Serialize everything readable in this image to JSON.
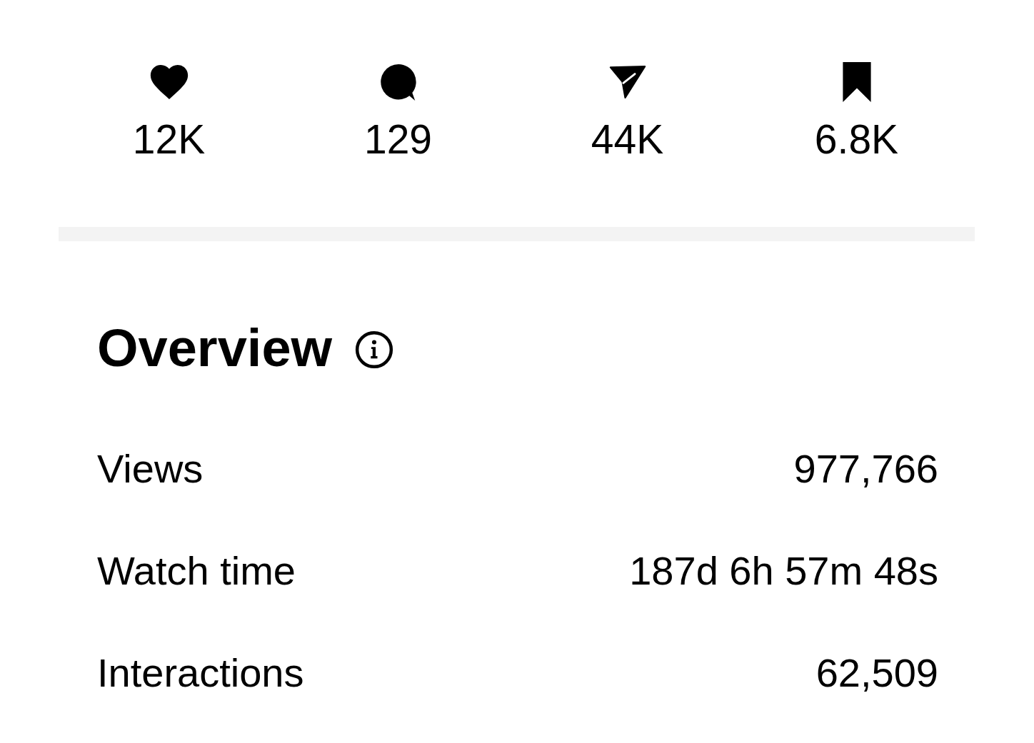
{
  "stats": [
    {
      "kind": "likes",
      "value": "12K"
    },
    {
      "kind": "comments",
      "value": "129"
    },
    {
      "kind": "shares",
      "value": "44K"
    },
    {
      "kind": "saves",
      "value": "6.8K"
    }
  ],
  "overview": {
    "title": "Overview",
    "rows": [
      {
        "label": "Views",
        "value": "977,766"
      },
      {
        "label": "Watch time",
        "value": "187d 6h 57m 48s"
      },
      {
        "label": "Interactions",
        "value": "62,509"
      }
    ]
  }
}
